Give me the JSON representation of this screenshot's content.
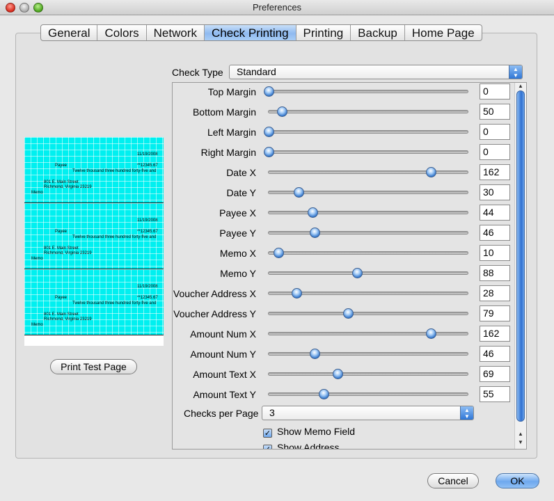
{
  "window": {
    "title": "Preferences"
  },
  "tabs": [
    {
      "label": "General"
    },
    {
      "label": "Colors"
    },
    {
      "label": "Network"
    },
    {
      "label": "Check Printing"
    },
    {
      "label": "Printing"
    },
    {
      "label": "Backup"
    },
    {
      "label": "Home Page"
    }
  ],
  "active_tab": "Check Printing",
  "preview": {
    "date": "11/19/2008",
    "payee": "Payee",
    "amount_num": "**12345.67",
    "amount_text": "Twelve thousand three hundred forty-five  and",
    "address_line1": "801 E. Main Street",
    "address_line2": "Richmond, Virginia 23219",
    "memo": "Memo",
    "print_button": "Print Test Page"
  },
  "check_type": {
    "label": "Check Type",
    "value": "Standard"
  },
  "fields": [
    {
      "label": "Top Margin",
      "value": "0",
      "slider": 0.0
    },
    {
      "label": "Bottom Margin",
      "value": "50",
      "slider": 0.065
    },
    {
      "label": "Left Margin",
      "value": "0",
      "slider": 0.0
    },
    {
      "label": "Right Margin",
      "value": "0",
      "slider": 0.0
    },
    {
      "label": "Date X",
      "value": "162",
      "slider": 0.81
    },
    {
      "label": "Date Y",
      "value": "30",
      "slider": 0.15
    },
    {
      "label": "Payee X",
      "value": "44",
      "slider": 0.22
    },
    {
      "label": "Payee Y",
      "value": "46",
      "slider": 0.23
    },
    {
      "label": "Memo X",
      "value": "10",
      "slider": 0.05
    },
    {
      "label": "Memo Y",
      "value": "88",
      "slider": 0.44
    },
    {
      "label": "Voucher Address X",
      "value": "28",
      "slider": 0.14
    },
    {
      "label": "Voucher Address Y",
      "value": "79",
      "slider": 0.395
    },
    {
      "label": "Amount Num X",
      "value": "162",
      "slider": 0.81
    },
    {
      "label": "Amount Num Y",
      "value": "46",
      "slider": 0.23
    },
    {
      "label": "Amount Text X",
      "value": "69",
      "slider": 0.345
    },
    {
      "label": "Amount Text Y",
      "value": "55",
      "slider": 0.275
    }
  ],
  "checks_per_page": {
    "label": "Checks per Page",
    "value": "3"
  },
  "checkboxes": [
    {
      "label": "Show Memo Field",
      "checked": true
    },
    {
      "label": "Show Address",
      "checked": true
    }
  ],
  "buttons": {
    "cancel": "Cancel",
    "ok": "OK"
  }
}
